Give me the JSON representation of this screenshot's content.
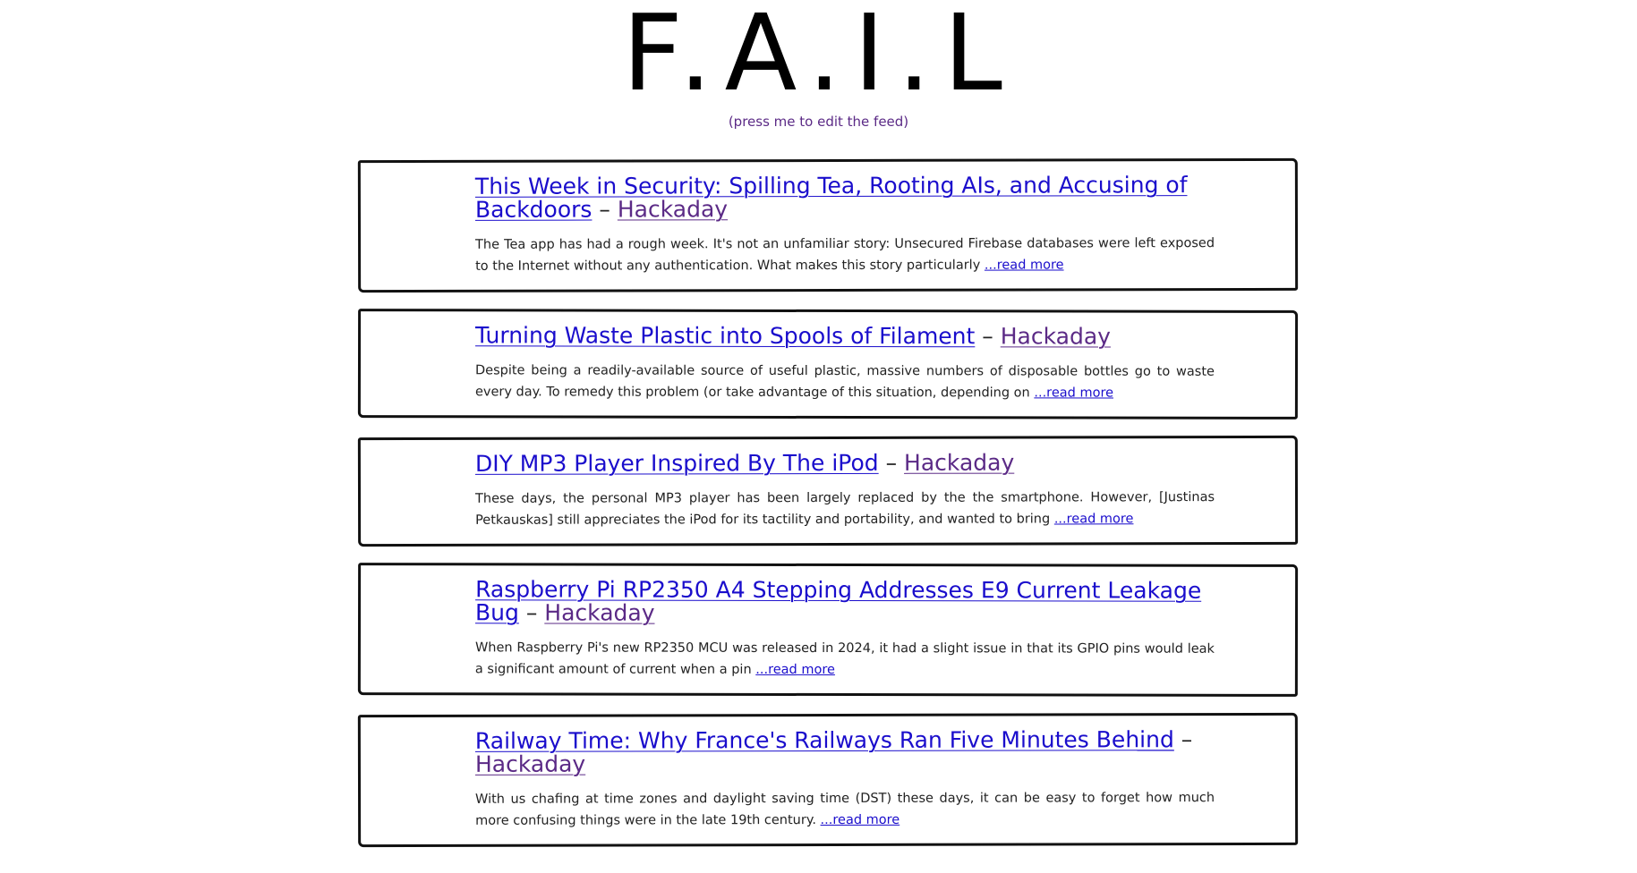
{
  "site": {
    "title": "F.A.I.L",
    "edit_link": "(press me to edit the feed)"
  },
  "colors": {
    "title_link": "#1a0dcc",
    "source_link": "#5b2a86",
    "border": "#111111"
  },
  "feed": {
    "separator": "–",
    "read_more_label": "...read more",
    "items": [
      {
        "title": "This Week in Security: Spilling Tea, Rooting AIs, and Accusing of Backdoors",
        "source": "Hackaday",
        "description": "The Tea app has had a rough week. It's not an unfamiliar story: Unsecured Firebase databases were left exposed to the Internet without any authentication. What makes this story particularly"
      },
      {
        "title": "Turning Waste Plastic into Spools of Filament",
        "source": "Hackaday",
        "description": "Despite being a readily-available source of useful plastic, massive numbers of disposable bottles go to waste every day. To remedy this problem (or take advantage of this situation, depending on"
      },
      {
        "title": "DIY MP3 Player Inspired By The iPod",
        "source": "Hackaday",
        "description": "These days, the personal MP3 player has been largely replaced by the the smartphone. However, [Justinas Petkauskas] still appreciates the iPod for its tactility and portability, and wanted to bring"
      },
      {
        "title": "Raspberry Pi RP2350 A4 Stepping Addresses E9 Current Leakage Bug",
        "source": "Hackaday",
        "description": "When Raspberry Pi's new RP2350 MCU was released in 2024, it had a slight issue in that its GPIO pins would leak a significant amount of current when a pin"
      },
      {
        "title": "Railway Time: Why France's Railways Ran Five Minutes Behind",
        "source": "Hackaday",
        "description": "With us chafing at time zones and daylight saving time (DST) these days, it can be easy to forget how much more confusing things were in the late 19th century."
      }
    ]
  }
}
